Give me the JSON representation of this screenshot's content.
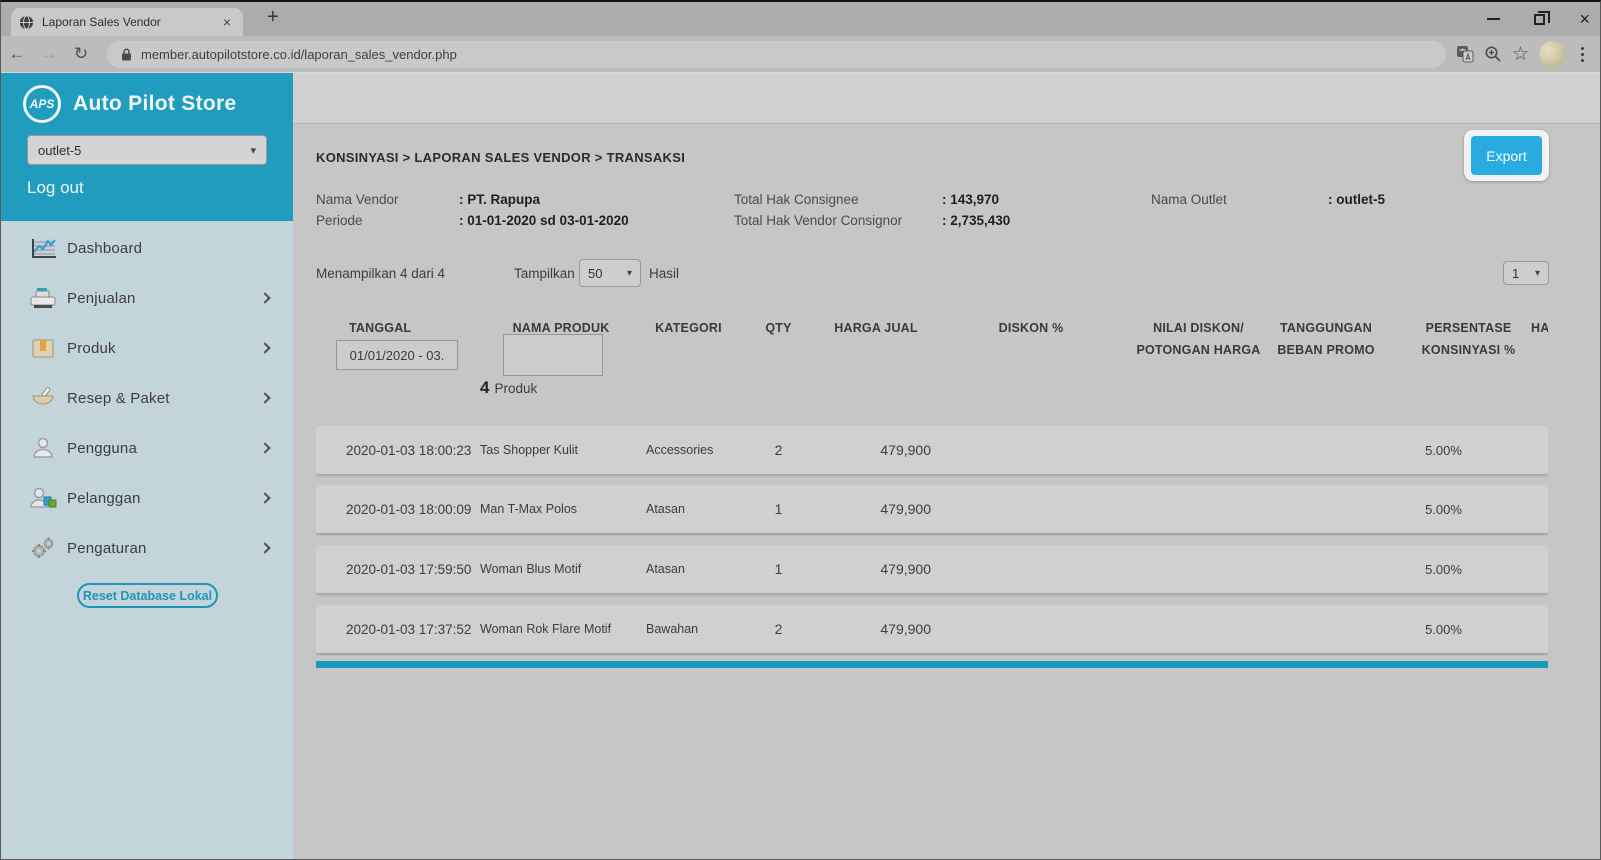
{
  "browser": {
    "tab_title": "Laporan Sales Vendor",
    "url": "member.autopilotstore.co.id/laporan_sales_vendor.php"
  },
  "icons": {
    "close": "×",
    "new_tab": "+",
    "back": "←",
    "forward": "→",
    "refresh": "↻",
    "star": "☆",
    "dropdown_arrow": "▾"
  },
  "colors": {
    "sidebar_teal": "#1f9cbe",
    "export_blue": "#29abe2",
    "scrollbar_teal": "#1b99bd"
  },
  "sidebar": {
    "logo_text": "APS",
    "app_name": "Auto Pilot Store",
    "outlet_select_value": "outlet-5",
    "logout_label": "Log out",
    "menu": [
      {
        "label": "Dashboard"
      },
      {
        "label": "Penjualan"
      },
      {
        "label": "Produk"
      },
      {
        "label": "Resep & Paket"
      },
      {
        "label": "Pengguna"
      },
      {
        "label": "Pelanggan"
      },
      {
        "label": "Pengaturan"
      }
    ],
    "reset_button_label": "Reset Database Lokal"
  },
  "page": {
    "breadcrumb": "KONSINYASI > LAPORAN SALES VENDOR  > TRANSAKSI",
    "export_label": "Export",
    "info": {
      "nama_vendor_label": "Nama Vendor",
      "nama_vendor_value": ": PT. Rapupa",
      "periode_label": "Periode",
      "periode_value": ": 01-01-2020 sd 03-01-2020",
      "total_hak_consignee_label": "Total Hak Consignee",
      "total_hak_consignee_value": ": 143,970",
      "total_hak_vendor_label": "Total Hak Vendor Consignor",
      "total_hak_vendor_value": ": 2,735,430",
      "nama_outlet_label": "Nama Outlet",
      "nama_outlet_value": ": outlet-5"
    },
    "controls": {
      "showing_text": "Menampilkan 4 dari 4",
      "tampilkan_label": "Tampilkan",
      "page_size_value": "50",
      "hasil_label": "Hasil",
      "page_select_value": "1"
    }
  },
  "table": {
    "columns": [
      {
        "line1": "TANGGAL",
        "line2": ""
      },
      {
        "line1": "NAMA PRODUK",
        "line2": ""
      },
      {
        "line1": "KATEGORI",
        "line2": ""
      },
      {
        "line1": "QTY",
        "line2": ""
      },
      {
        "line1": "HARGA JUAL",
        "line2": ""
      },
      {
        "line1": "DISKON %",
        "line2": ""
      },
      {
        "line1": "NILAI DISKON/",
        "line2": "POTONGAN HARGA"
      },
      {
        "line1": "TANGGUNGAN",
        "line2": "BEBAN PROMO"
      },
      {
        "line1": "PERSENTASE",
        "line2": "KONSINYASI %"
      },
      {
        "line1": "HA",
        "line2": ""
      }
    ],
    "filters": {
      "tanggal_value": "01/01/2020 - 03.",
      "nama_produk_value": ""
    },
    "product_count_number": "4",
    "product_count_label": "Produk",
    "rows": [
      {
        "tanggal": "2020-01-03 18:00:23",
        "nama_produk": "Tas Shopper Kulit",
        "kategori": "Accessories",
        "qty": "2",
        "harga_jual": "479,900",
        "diskon": "",
        "nilai_diskon": "",
        "tanggungan": "",
        "persentase": "5.00%"
      },
      {
        "tanggal": "2020-01-03 18:00:09",
        "nama_produk": "Man T-Max Polos",
        "kategori": "Atasan",
        "qty": "1",
        "harga_jual": "479,900",
        "diskon": "",
        "nilai_diskon": "",
        "tanggungan": "",
        "persentase": "5.00%"
      },
      {
        "tanggal": "2020-01-03 17:59:50",
        "nama_produk": "Woman Blus Motif",
        "kategori": "Atasan",
        "qty": "1",
        "harga_jual": "479,900",
        "diskon": "",
        "nilai_diskon": "",
        "tanggungan": "",
        "persentase": "5.00%"
      },
      {
        "tanggal": "2020-01-03 17:37:52",
        "nama_produk": "Woman Rok Flare Motif",
        "kategori": "Bawahan",
        "qty": "2",
        "harga_jual": "479,900",
        "diskon": "",
        "nilai_diskon": "",
        "tanggungan": "",
        "persentase": "5.00%"
      }
    ]
  }
}
